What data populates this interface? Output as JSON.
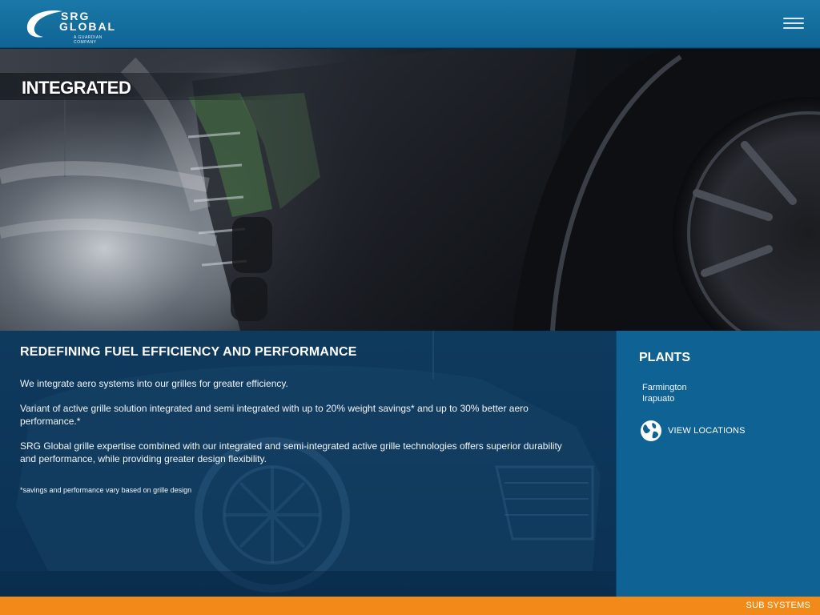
{
  "header": {
    "logo_line1": "SRG",
    "logo_line2": "GLOBAL",
    "logo_sub": "A GUARDIAN COMPANY",
    "menu_icon": "hamburger-menu-icon"
  },
  "hero": {
    "title": "INTEGRATED"
  },
  "content": {
    "title": "REDEFINING FUEL EFFICIENCY AND PERFORMANCE",
    "paragraph1": "We integrate aero systems into our grilles for greater efficiency.",
    "paragraph2": "Variant of active grille solution integrated and semi integrated with up to 20% weight savings* and up to 30% better aero performance.*",
    "paragraph3": "SRG Global grille expertise combined with our integrated and semi-integrated active grille technologies offers superior durability and performance, while providing greater design flexibility.",
    "footnote": "*savings and performance vary based on grille design"
  },
  "plants": {
    "title": "PLANTS",
    "items": [
      "Farmington",
      "Irapuato"
    ],
    "view_locations_label": "VIEW LOCATIONS",
    "view_locations_icon": "globe-icon"
  },
  "footer": {
    "sub_systems_label": "SUB SYSTEMS"
  },
  "colors": {
    "header_blue": "#1a78a8",
    "plants_blue": "#0f6294",
    "content_navy": "#0e3a5e",
    "footer_orange": "#f28a1a"
  }
}
